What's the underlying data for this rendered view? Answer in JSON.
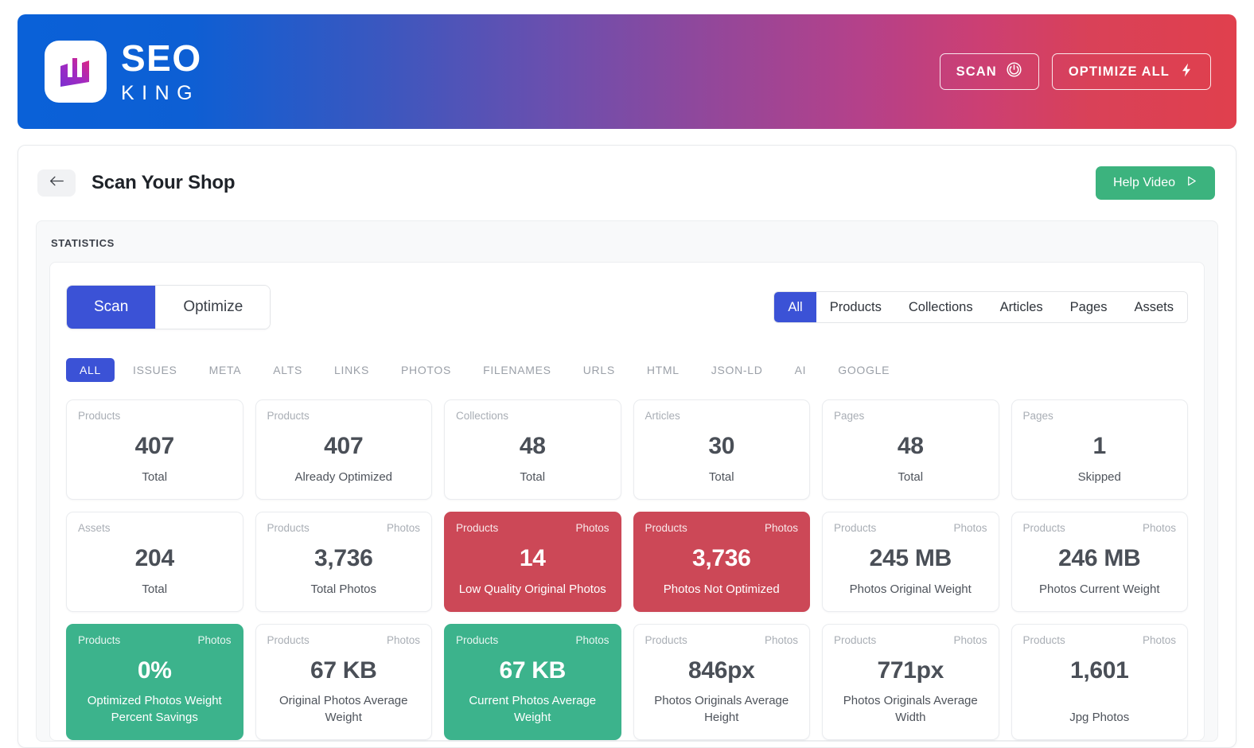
{
  "banner": {
    "brand_primary": "SEO",
    "brand_secondary": "KING",
    "logo_icon": "bar-chart-logo-icon",
    "scan_button": "SCAN",
    "scan_icon": "radar-power-icon",
    "optimize_button": "OPTIMIZE ALL",
    "optimize_icon": "lightning-bolt-icon",
    "gradient_start": "#0a61d8",
    "gradient_end": "#e0404d"
  },
  "page": {
    "back_icon": "arrow-left-icon",
    "title": "Scan Your Shop",
    "help_label": "Help Video",
    "help_icon": "play-triangle-icon",
    "help_color": "#3cb37e"
  },
  "statistics": {
    "section_label": "STATISTICS",
    "mode_tabs": [
      {
        "label": "Scan",
        "active": true
      },
      {
        "label": "Optimize",
        "active": false
      }
    ],
    "scope_filters": [
      {
        "label": "All",
        "active": true
      },
      {
        "label": "Products",
        "active": false
      },
      {
        "label": "Collections",
        "active": false
      },
      {
        "label": "Articles",
        "active": false
      },
      {
        "label": "Pages",
        "active": false
      },
      {
        "label": "Assets",
        "active": false
      }
    ],
    "sub_tabs": [
      {
        "label": "ALL",
        "active": true
      },
      {
        "label": "ISSUES",
        "active": false
      },
      {
        "label": "META",
        "active": false
      },
      {
        "label": "ALTS",
        "active": false
      },
      {
        "label": "LINKS",
        "active": false
      },
      {
        "label": "PHOTOS",
        "active": false
      },
      {
        "label": "FILENAMES",
        "active": false
      },
      {
        "label": "URLS",
        "active": false
      },
      {
        "label": "HTML",
        "active": false
      },
      {
        "label": "JSON-LD",
        "active": false
      },
      {
        "label": "AI",
        "active": false
      },
      {
        "label": "GOOGLE",
        "active": false
      }
    ],
    "accent_active": "#3b52d6",
    "color_alert": "#cc4857",
    "color_good": "#3cb38c",
    "cards": [
      {
        "top_left": "Products",
        "top_right": "",
        "value": "407",
        "label": "Total",
        "tone": "plain"
      },
      {
        "top_left": "Products",
        "top_right": "",
        "value": "407",
        "label": "Already Optimized",
        "tone": "plain"
      },
      {
        "top_left": "Collections",
        "top_right": "",
        "value": "48",
        "label": "Total",
        "tone": "plain"
      },
      {
        "top_left": "Articles",
        "top_right": "",
        "value": "30",
        "label": "Total",
        "tone": "plain"
      },
      {
        "top_left": "Pages",
        "top_right": "",
        "value": "48",
        "label": "Total",
        "tone": "plain"
      },
      {
        "top_left": "Pages",
        "top_right": "",
        "value": "1",
        "label": "Skipped",
        "tone": "plain"
      },
      {
        "top_left": "Assets",
        "top_right": "",
        "value": "204",
        "label": "Total",
        "tone": "plain"
      },
      {
        "top_left": "Products",
        "top_right": "Photos",
        "value": "3,736",
        "label": "Total Photos",
        "tone": "plain"
      },
      {
        "top_left": "Products",
        "top_right": "Photos",
        "value": "14",
        "label": "Low Quality Original Photos",
        "tone": "red"
      },
      {
        "top_left": "Products",
        "top_right": "Photos",
        "value": "3,736",
        "label": "Photos Not Optimized",
        "tone": "red"
      },
      {
        "top_left": "Products",
        "top_right": "Photos",
        "value": "245 MB",
        "label": "Photos Original Weight",
        "tone": "plain"
      },
      {
        "top_left": "Products",
        "top_right": "Photos",
        "value": "246 MB",
        "label": "Photos Current Weight",
        "tone": "plain"
      },
      {
        "top_left": "Products",
        "top_right": "Photos",
        "value": "0%",
        "label": "Optimized Photos Weight Percent Savings",
        "tone": "green"
      },
      {
        "top_left": "Products",
        "top_right": "Photos",
        "value": "67 KB",
        "label": "Original Photos Average Weight",
        "tone": "plain"
      },
      {
        "top_left": "Products",
        "top_right": "Photos",
        "value": "67 KB",
        "label": "Current Photos Average Weight",
        "tone": "green"
      },
      {
        "top_left": "Products",
        "top_right": "Photos",
        "value": "846px",
        "label": "Photos Originals Average Height",
        "tone": "plain"
      },
      {
        "top_left": "Products",
        "top_right": "Photos",
        "value": "771px",
        "label": "Photos Originals Average Width",
        "tone": "plain"
      },
      {
        "top_left": "Products",
        "top_right": "Photos",
        "value": "1,601",
        "label": "Jpg Photos",
        "tone": "plain"
      }
    ]
  }
}
